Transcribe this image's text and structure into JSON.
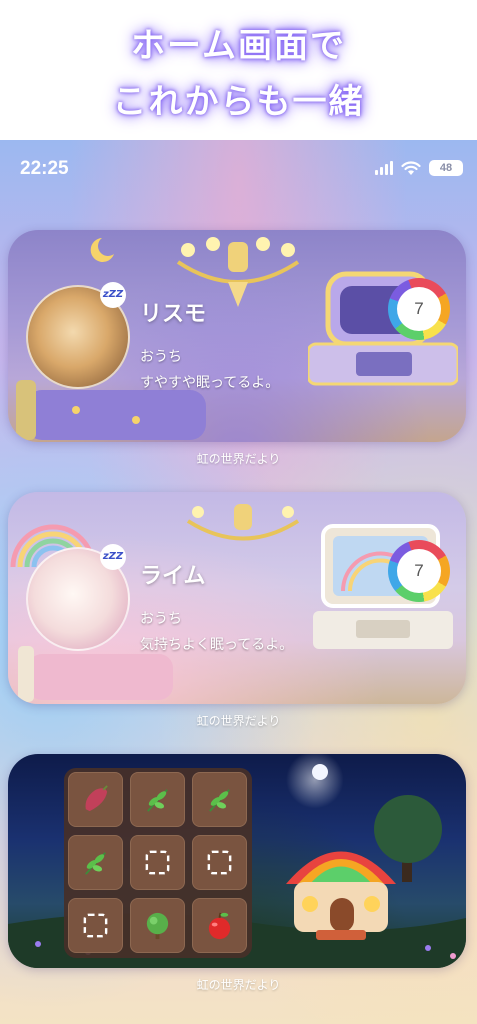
{
  "promo": {
    "line1": "ホーム画面で",
    "line2": "これからも一緒"
  },
  "status_bar": {
    "time": "22:25",
    "battery": "48"
  },
  "widgets": [
    {
      "pet_name": "リスモ",
      "location": "おうち",
      "status": "すやすや眠ってるよ。",
      "level": "7",
      "caption": "虹の世界だより",
      "sleep_badge": "zZZ"
    },
    {
      "pet_name": "ライム",
      "location": "おうち",
      "status": "気持ちよく眠ってるよ。",
      "level": "7",
      "caption": "虹の世界だより",
      "sleep_badge": "zZZ"
    }
  ],
  "inventory_widget": {
    "caption": "虹の世界だより",
    "slots": [
      {
        "item": "sweet-potato-icon"
      },
      {
        "item": "leaf-icon"
      },
      {
        "item": "leaf-icon"
      },
      {
        "item": "leaf-icon"
      },
      {
        "item": "empty-slot-icon"
      },
      {
        "item": "empty-slot-icon"
      },
      {
        "item": "empty-slot-icon"
      },
      {
        "item": "tree-icon"
      },
      {
        "item": "apple-icon"
      }
    ]
  },
  "colors": {
    "promo_glow": "#8a6cf5",
    "ring_segments": [
      "#e94b5b",
      "#f5a623",
      "#f8e14b",
      "#5ccf6a",
      "#3fa7e8",
      "#7b5ce0"
    ]
  }
}
